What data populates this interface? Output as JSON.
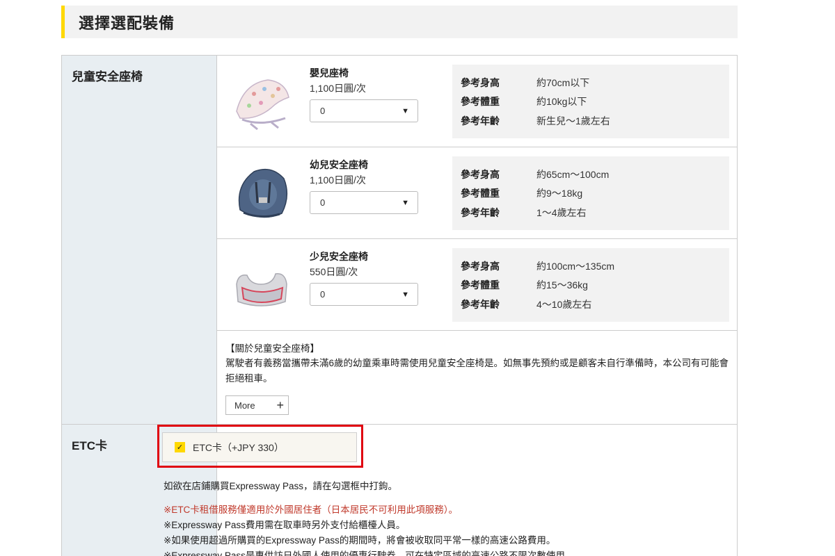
{
  "section_title": "選擇選配裝備",
  "child_seat": {
    "label": "兒童安全座椅",
    "items": [
      {
        "name": "嬰兒座椅",
        "price": "1,100日圓/次",
        "quantity": "0",
        "specs": [
          {
            "key": "參考身高",
            "value": "約70cm以下"
          },
          {
            "key": "參考體重",
            "value": "約10kg以下"
          },
          {
            "key": "參考年齡",
            "value": "新生兒～1歲左右"
          }
        ]
      },
      {
        "name": "幼兒安全座椅",
        "price": "1,100日圓/次",
        "quantity": "0",
        "specs": [
          {
            "key": "參考身高",
            "value": "約65cm～100cm"
          },
          {
            "key": "參考體重",
            "value": "約9～18kg"
          },
          {
            "key": "參考年齡",
            "value": "1～4歲左右"
          }
        ]
      },
      {
        "name": "少兒安全座椅",
        "price": "550日圓/次",
        "quantity": "0",
        "specs": [
          {
            "key": "參考身高",
            "value": "約100cm～135cm"
          },
          {
            "key": "參考體重",
            "value": "約15～36kg"
          },
          {
            "key": "參考年齡",
            "value": "4～10歲左右"
          }
        ]
      }
    ],
    "note_title": "【關於兒童安全座椅】",
    "note_body": "駕駛者有義務當攜帶未滿6歲的幼童乘車時需使用兒童安全座椅是。如無事先預約或是顧客未自行準備時，本公司有可能會拒絕租車。",
    "more_label": "More",
    "more_icon": "plus-icon"
  },
  "etc": {
    "label": "ETC卡",
    "option_label": "ETC卡（+JPY 330）",
    "checked": true,
    "instruction": "如欲在店鋪購買Expressway Pass，請在勾選框中打鉤。",
    "notes": [
      "※ETC卡租借服務僅適用於外國居住者（日本居民不可利用此項服務）。",
      "※Expressway Pass費用需在取車時另外支付給櫃檯人員。",
      "※如果使用超過所購買的Expressway Pass的期間時，將會被收取同平常一樣的高速公路費用。",
      "※Expressway Pass是專供訪日外國人使用的優惠行駛券，可在特定區域的高速公路不限次數使用。"
    ]
  },
  "colors": {
    "accent_yellow": "#ffd800",
    "highlight_red": "#e00010",
    "label_bg": "#e8eef2",
    "warning_red": "#c0392b"
  }
}
